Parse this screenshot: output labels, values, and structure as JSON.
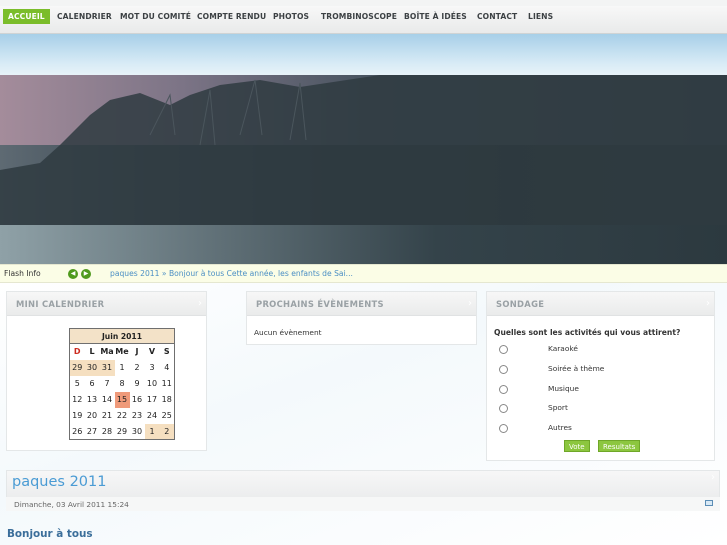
{
  "nav": {
    "items": [
      "ACCUEIL",
      "CALENDRIER",
      "MOT DU COMITÉ",
      "COMPTE RENDU",
      "PHOTOS",
      "TROMBINOSCOPE",
      "BOÎTE À IDÉES",
      "CONTACT",
      "LIENS"
    ],
    "active": "ACCUEIL",
    "accent_color": "#7bbd2a"
  },
  "flash": {
    "label": "Flash Info",
    "prev_icon": "arrow-left-icon",
    "next_icon": "arrow-right-icon",
    "text": "paques 2011 » Bonjour à tous   Cette année, les enfants de Sai..."
  },
  "mini_calendar": {
    "title": "MINI CALENDRIER",
    "month": "Juin 2011",
    "weekdays": [
      "D",
      "L",
      "Ma",
      "Me",
      "J",
      "V",
      "S"
    ],
    "weeks": [
      [
        "29",
        "30",
        "31",
        "1",
        "2",
        "3",
        "4"
      ],
      [
        "5",
        "6",
        "7",
        "8",
        "9",
        "10",
        "11"
      ],
      [
        "12",
        "13",
        "14",
        "15",
        "16",
        "17",
        "18"
      ],
      [
        "19",
        "20",
        "21",
        "22",
        "23",
        "24",
        "25"
      ],
      [
        "26",
        "27",
        "28",
        "29",
        "30",
        "1",
        "2"
      ]
    ],
    "today": "15",
    "other_month_color": "#f5dfc0",
    "today_color": "#ef9a7a"
  },
  "events": {
    "title": "PROCHAINS ÉVÈNEMENTS",
    "empty_text": "Aucun évènement"
  },
  "poll": {
    "title": "SONDAGE",
    "question": "Quelles sont les activités qui vous attirent?",
    "options": [
      "Karaoké",
      "Soirée à thème",
      "Musique",
      "Sport",
      "Autres"
    ],
    "vote_label": "Vote",
    "results_label": "Resultats"
  },
  "article": {
    "title": "paques 2011",
    "date": "Dimanche, 03 Avril 2011 15:24",
    "intro": "Bonjour à tous",
    "email_icon": "email-icon"
  }
}
